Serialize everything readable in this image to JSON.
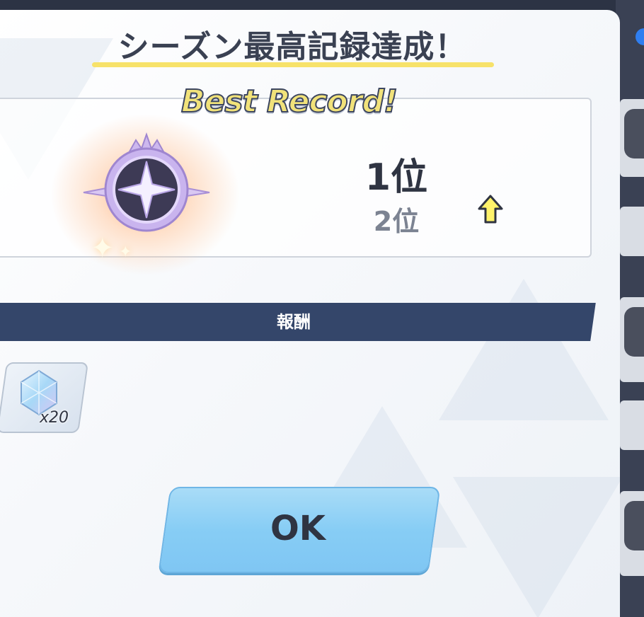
{
  "dialog": {
    "title": "シーズン最高記録達成！",
    "banner": "Best Record!",
    "rank": {
      "new": "1位",
      "old": "2位",
      "trend_icon": "up-arrow-icon"
    },
    "rewards": {
      "header": "報酬",
      "items": [
        {
          "icon": "crystal-icon",
          "count": "x20"
        }
      ]
    },
    "ok_label": "OK"
  },
  "colors": {
    "title_text": "#3a4152",
    "title_underline": "#f7e26a",
    "band": "#34466a",
    "ok_button": "#87cdf5",
    "arrow": "#fff36b"
  }
}
